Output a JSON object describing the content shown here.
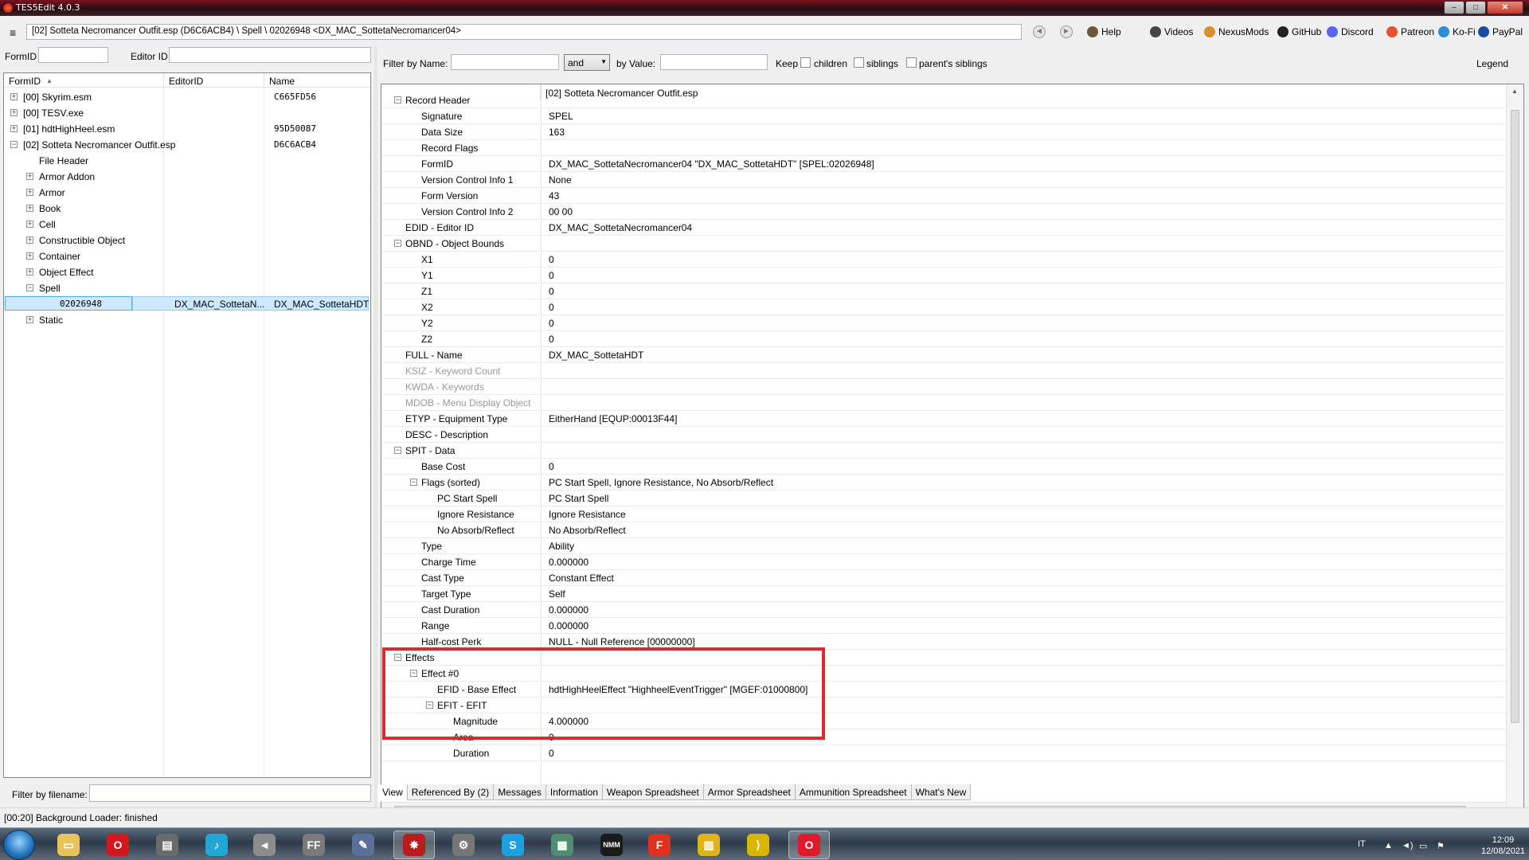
{
  "window": {
    "title": "TES5Edit 4.0.3",
    "controls": [
      "–",
      "□",
      "✕"
    ]
  },
  "toolbar": {
    "path": "[02] Sotteta Necromancer Outfit.esp (D6C6ACB4) \\ Spell \\ 02026948 <DX_MAC_SottetaNecromancer04>",
    "links": [
      {
        "label": "Help",
        "icon": "help-book-icon",
        "color": "#6b5a3a"
      },
      {
        "label": "Videos",
        "icon": "videos-icon",
        "color": "#444444"
      },
      {
        "label": "NexusMods",
        "icon": "nexusmods-icon",
        "color": "#d98f2b"
      },
      {
        "label": "GitHub",
        "icon": "github-icon",
        "color": "#222222"
      },
      {
        "label": "Discord",
        "icon": "discord-icon",
        "color": "#5865f2"
      },
      {
        "label": "Patreon",
        "icon": "patreon-icon",
        "color": "#e8532d"
      },
      {
        "label": "Ko-Fi",
        "icon": "kofi-icon",
        "color": "#2a8fd6"
      },
      {
        "label": "PayPal",
        "icon": "paypal-icon",
        "color": "#1a4ba0"
      }
    ]
  },
  "left": {
    "formid_label": "FormID",
    "editorid_label": "Editor ID",
    "headers": {
      "formid": "FormID",
      "sort_arrow": "▲",
      "editorid": "EditorID",
      "name": "Name"
    },
    "tree": [
      {
        "exp": "+",
        "label": "[00] Skyrim.esm",
        "col2": "C665FD56",
        "indent": 0
      },
      {
        "exp": "+",
        "label": "[00] TESV.exe",
        "col2": "",
        "indent": 0
      },
      {
        "exp": "+",
        "label": "[01] hdtHighHeel.esm",
        "col2": "95D50087",
        "indent": 0
      },
      {
        "exp": "−",
        "label": "[02] Sotteta Necromancer Outfit.esp",
        "col2": "D6C6ACB4",
        "indent": 0
      },
      {
        "exp": "",
        "label": "File Header",
        "col2": "",
        "indent": 1
      },
      {
        "exp": "+",
        "label": "Armor Addon",
        "col2": "",
        "indent": 1
      },
      {
        "exp": "+",
        "label": "Armor",
        "col2": "",
        "indent": 1
      },
      {
        "exp": "+",
        "label": "Book",
        "col2": "",
        "indent": 1
      },
      {
        "exp": "+",
        "label": "Cell",
        "col2": "",
        "indent": 1
      },
      {
        "exp": "+",
        "label": "Constructible Object",
        "col2": "",
        "indent": 1
      },
      {
        "exp": "+",
        "label": "Container",
        "col2": "",
        "indent": 1
      },
      {
        "exp": "+",
        "label": "Object Effect",
        "col2": "",
        "indent": 1
      },
      {
        "exp": "−",
        "label": "Spell",
        "col2": "",
        "indent": 1
      },
      {
        "exp": "",
        "label": "02026948",
        "col2": "",
        "indent": 2,
        "selected": true,
        "editorid": "DX_MAC_SottetaN...",
        "name": "DX_MAC_SottetaHDT"
      },
      {
        "exp": "+",
        "label": "Static",
        "col2": "",
        "indent": 1
      }
    ],
    "filter_label": "Filter by filename:"
  },
  "filter": {
    "by_name_label": "Filter by Name:",
    "and_value": "and",
    "by_value_label": "by Value:",
    "keep_label": "Keep",
    "children_label": "children",
    "siblings_label": "siblings",
    "parents_siblings_label": "parent's siblings",
    "legend_label": "Legend"
  },
  "grid": {
    "header": "[02] Sotteta Necromancer Outfit.esp",
    "rows": [
      {
        "level": 0,
        "exp": "−",
        "name": "Record Header",
        "value": ""
      },
      {
        "level": 1,
        "exp": "",
        "name": "Signature",
        "value": "SPEL"
      },
      {
        "level": 1,
        "exp": "",
        "name": "Data Size",
        "value": "163"
      },
      {
        "level": 1,
        "exp": "",
        "name": "Record Flags",
        "value": ""
      },
      {
        "level": 1,
        "exp": "",
        "name": "FormID",
        "value": "DX_MAC_SottetaNecromancer04 \"DX_MAC_SottetaHDT\" [SPEL:02026948]"
      },
      {
        "level": 1,
        "exp": "",
        "name": "Version Control Info 1",
        "value": "None"
      },
      {
        "level": 1,
        "exp": "",
        "name": "Form Version",
        "value": "43"
      },
      {
        "level": 1,
        "exp": "",
        "name": "Version Control Info 2",
        "value": "00 00"
      },
      {
        "level": 0,
        "exp": "",
        "name": "EDID - Editor ID",
        "value": "DX_MAC_SottetaNecromancer04"
      },
      {
        "level": 0,
        "exp": "−",
        "name": "OBND - Object Bounds",
        "value": ""
      },
      {
        "level": 1,
        "exp": "",
        "name": "X1",
        "value": "0"
      },
      {
        "level": 1,
        "exp": "",
        "name": "Y1",
        "value": "0"
      },
      {
        "level": 1,
        "exp": "",
        "name": "Z1",
        "value": "0"
      },
      {
        "level": 1,
        "exp": "",
        "name": "X2",
        "value": "0"
      },
      {
        "level": 1,
        "exp": "",
        "name": "Y2",
        "value": "0"
      },
      {
        "level": 1,
        "exp": "",
        "name": "Z2",
        "value": "0"
      },
      {
        "level": 0,
        "exp": "",
        "name": "FULL - Name",
        "value": "DX_MAC_SottetaHDT"
      },
      {
        "level": 0,
        "exp": "",
        "name": "KSIZ - Keyword Count",
        "value": "",
        "dim": true
      },
      {
        "level": 0,
        "exp": "",
        "name": "KWDA - Keywords",
        "value": "",
        "dim": true
      },
      {
        "level": 0,
        "exp": "",
        "name": "MDOB - Menu Display Object",
        "value": "",
        "dim": true
      },
      {
        "level": 0,
        "exp": "",
        "name": "ETYP - Equipment Type",
        "value": "EitherHand [EQUP:00013F44]"
      },
      {
        "level": 0,
        "exp": "",
        "name": "DESC - Description",
        "value": ""
      },
      {
        "level": 0,
        "exp": "−",
        "name": "SPIT - Data",
        "value": ""
      },
      {
        "level": 1,
        "exp": "",
        "name": "Base Cost",
        "value": "0"
      },
      {
        "level": 1,
        "exp": "−",
        "name": "Flags (sorted)",
        "value": "PC Start Spell, Ignore Resistance, No Absorb/Reflect"
      },
      {
        "level": 2,
        "exp": "",
        "name": "PC Start Spell",
        "value": "PC Start Spell"
      },
      {
        "level": 2,
        "exp": "",
        "name": "Ignore Resistance",
        "value": "Ignore Resistance"
      },
      {
        "level": 2,
        "exp": "",
        "name": "No Absorb/Reflect",
        "value": "No Absorb/Reflect"
      },
      {
        "level": 1,
        "exp": "",
        "name": "Type",
        "value": "Ability"
      },
      {
        "level": 1,
        "exp": "",
        "name": "Charge Time",
        "value": "0.000000"
      },
      {
        "level": 1,
        "exp": "",
        "name": "Cast Type",
        "value": "Constant Effect"
      },
      {
        "level": 1,
        "exp": "",
        "name": "Target Type",
        "value": "Self"
      },
      {
        "level": 1,
        "exp": "",
        "name": "Cast Duration",
        "value": "0.000000"
      },
      {
        "level": 1,
        "exp": "",
        "name": "Range",
        "value": "0.000000"
      },
      {
        "level": 1,
        "exp": "",
        "name": "Half-cost Perk",
        "value": "NULL - Null Reference [00000000]"
      },
      {
        "level": 0,
        "exp": "−",
        "name": "Effects",
        "value": ""
      },
      {
        "level": 1,
        "exp": "−",
        "name": "Effect #0",
        "value": ""
      },
      {
        "level": 2,
        "exp": "",
        "name": "EFID - Base Effect",
        "value": "hdtHighHeelEffect \"HighheelEventTrigger\" [MGEF:01000800]"
      },
      {
        "level": 2,
        "exp": "−",
        "name": "EFIT - EFIT",
        "value": ""
      },
      {
        "level": 3,
        "exp": "",
        "name": "Magnitude",
        "value": "4.000000"
      },
      {
        "level": 3,
        "exp": "",
        "name": "Area",
        "value": "0"
      },
      {
        "level": 3,
        "exp": "",
        "name": "Duration",
        "value": "0"
      }
    ]
  },
  "tabs": [
    "View",
    "Referenced By (2)",
    "Messages",
    "Information",
    "Weapon Spreadsheet",
    "Armor Spreadsheet",
    "Ammunition Spreadsheet",
    "What's New"
  ],
  "status": "[00:20] Background Loader: finished",
  "taskbar": {
    "apps": [
      {
        "icon": "explorer-icon",
        "glyph": "▭",
        "color": "#e8c35a",
        "active": false
      },
      {
        "icon": "opera-icon",
        "glyph": "O",
        "color": "#d4161d",
        "active": false
      },
      {
        "icon": "media-player-icon",
        "glyph": "▤",
        "color": "#6b6b6b",
        "active": false
      },
      {
        "icon": "music-icon",
        "glyph": "♪",
        "color": "#21a6d6",
        "active": false
      },
      {
        "icon": "speaker-icon",
        "glyph": "◄",
        "color": "#8c8c8c",
        "active": false
      },
      {
        "icon": "ffdec-icon",
        "glyph": "FF",
        "color": "#7a7a7a",
        "active": false
      },
      {
        "icon": "pen-icon",
        "glyph": "✎",
        "color": "#5a6f9a",
        "active": false
      },
      {
        "icon": "tes5edit-icon",
        "glyph": "✸",
        "color": "#b81c1c",
        "active": true
      },
      {
        "icon": "settings-app-icon",
        "glyph": "⚙",
        "color": "#777777",
        "active": false
      },
      {
        "icon": "skype-icon",
        "glyph": "S",
        "color": "#1ba0e2",
        "active": false
      },
      {
        "icon": "window-app-icon",
        "glyph": "▦",
        "color": "#4f8f6f",
        "active": false
      },
      {
        "icon": "nmm-icon",
        "glyph": "NMM",
        "color": "#1a1a1a",
        "active": false
      },
      {
        "icon": "f-app-icon",
        "glyph": "F",
        "color": "#e0301e",
        "active": false
      },
      {
        "icon": "folder-app-icon",
        "glyph": "▥",
        "color": "#e2b21a",
        "active": false
      },
      {
        "icon": "bolt-icon",
        "glyph": "⟩",
        "color": "#d9b700",
        "active": false
      },
      {
        "icon": "opera-gx-icon",
        "glyph": "O",
        "color": "#e01a2b",
        "active": true
      }
    ],
    "lang": "IT",
    "time": "12:09",
    "date": "12/08/2021"
  }
}
